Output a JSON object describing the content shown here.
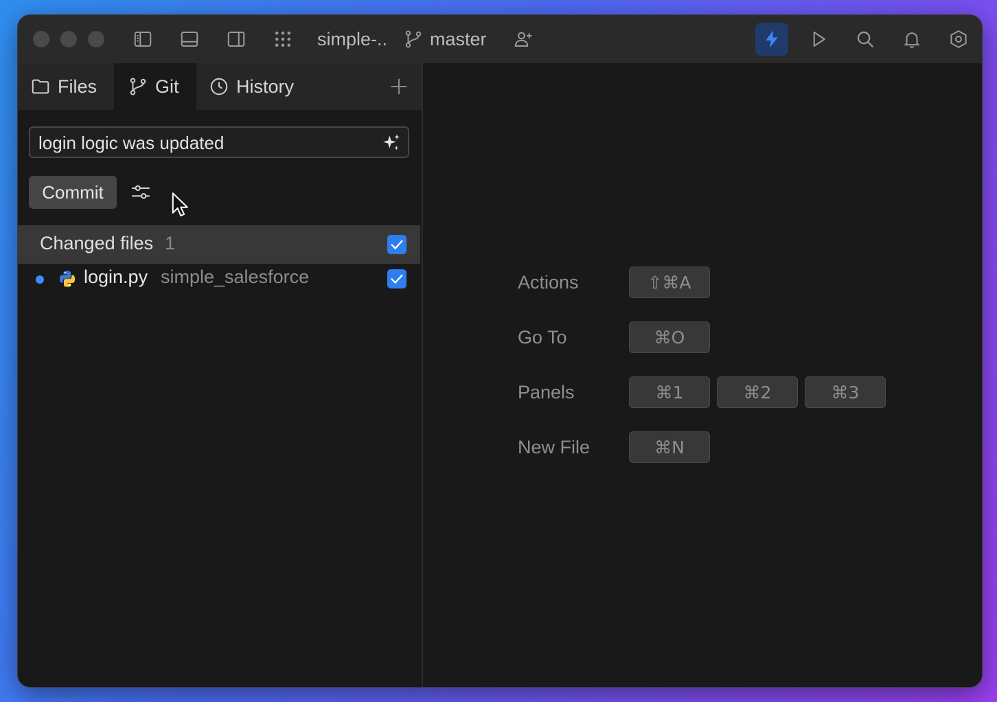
{
  "titlebar": {
    "project": "simple-..",
    "branch": "master"
  },
  "tabs": [
    {
      "label": "Files"
    },
    {
      "label": "Git"
    },
    {
      "label": "History"
    }
  ],
  "git": {
    "commit_message": "login logic was updated",
    "commit_label": "Commit",
    "changed_files_label": "Changed files",
    "changed_files_count": "1",
    "files": [
      {
        "name": "login.py",
        "dir": "simple_salesforce",
        "checked": true
      }
    ]
  },
  "shortcuts": [
    {
      "label": "Actions",
      "keys": [
        "⇧⌘A"
      ]
    },
    {
      "label": "Go To",
      "keys": [
        "⌘O"
      ]
    },
    {
      "label": "Panels",
      "keys": [
        "⌘1",
        "⌘2",
        "⌘3"
      ]
    },
    {
      "label": "New File",
      "keys": [
        "⌘N"
      ]
    }
  ],
  "colors": {
    "accent": "#2f7ef0",
    "active_icon_bg": "#1f3a6b"
  }
}
